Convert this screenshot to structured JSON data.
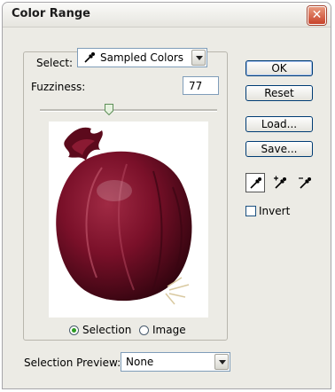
{
  "window": {
    "title": "Color Range",
    "close_symbol": "✕"
  },
  "select": {
    "label": "Select:",
    "value": "Sampled Colors"
  },
  "fuzziness": {
    "label": "Fuzziness:",
    "value": "77",
    "slider_fraction": 0.39
  },
  "preview_mode": {
    "options": [
      "Selection",
      "Image"
    ],
    "selected": "Selection"
  },
  "buttons": {
    "ok": "OK",
    "reset": "Reset",
    "load": "Load...",
    "save": "Save..."
  },
  "invert": {
    "label": "Invert",
    "checked": false
  },
  "selection_preview": {
    "label": "Selection Preview:",
    "value": "None"
  },
  "eyedroppers": [
    "eyedropper-icon",
    "eyedropper-plus-icon",
    "eyedropper-minus-icon"
  ],
  "colors": {
    "onion_dark": "#3a0613",
    "onion_mid": "#7a1029",
    "onion_light": "#a02a44",
    "accent": "#003c74"
  }
}
